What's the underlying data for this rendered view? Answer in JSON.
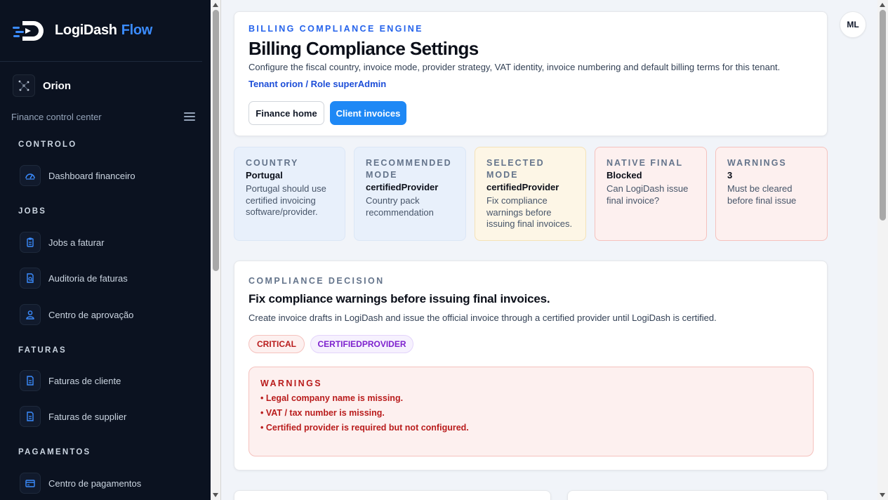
{
  "brand": {
    "name": "LogiDash",
    "flow": "Flow"
  },
  "tenant": {
    "name": "Orion",
    "subtitle": "Finance control center"
  },
  "sidebar": {
    "sections": [
      {
        "title": "CONTROLO",
        "items": [
          {
            "label": "Dashboard financeiro",
            "icon": "gauge-icon"
          }
        ]
      },
      {
        "title": "JOBS",
        "items": [
          {
            "label": "Jobs a faturar",
            "icon": "clipboard-icon"
          },
          {
            "label": "Auditoria de faturas",
            "icon": "document-search-icon"
          },
          {
            "label": "Centro de aprovação",
            "icon": "user-check-icon"
          }
        ]
      },
      {
        "title": "FATURAS",
        "items": [
          {
            "label": "Faturas de cliente",
            "icon": "document-icon"
          },
          {
            "label": "Faturas de supplier",
            "icon": "document-icon"
          }
        ]
      },
      {
        "title": "PAGAMENTOS",
        "items": [
          {
            "label": "Centro de pagamentos",
            "icon": "card-icon"
          }
        ]
      }
    ]
  },
  "header": {
    "eyebrow": "BILLING COMPLIANCE ENGINE",
    "title": "Billing Compliance Settings",
    "description": "Configure the fiscal country, invoice mode, provider strategy, VAT identity, invoice numbering and default billing terms for this tenant.",
    "tenant_line": "Tenant orion / Role superAdmin",
    "btn_home": "Finance home",
    "btn_invoices": "Client invoices"
  },
  "user": {
    "initials": "ML"
  },
  "stats": [
    {
      "label": "COUNTRY",
      "value": "Portugal",
      "desc": "Portugal should use certified invoicing software/provider."
    },
    {
      "label": "RECOMMENDED MODE",
      "value": "certifiedProvider",
      "desc": "Country pack recommendation"
    },
    {
      "label": "SELECTED MODE",
      "value": "certifiedProvider",
      "desc": "Fix compliance warnings before issuing final invoices."
    },
    {
      "label": "NATIVE FINAL",
      "value": "Blocked",
      "desc": "Can LogiDash issue final invoice?"
    },
    {
      "label": "WARNINGS",
      "value": "3",
      "desc": "Must be cleared before final issue"
    }
  ],
  "decision": {
    "eyebrow": "COMPLIANCE DECISION",
    "title": "Fix compliance warnings before issuing final invoices.",
    "description": "Create invoice drafts in LogiDash and issue the official invoice through a certified provider until LogiDash is certified.",
    "pill_critical": "CRITICAL",
    "pill_mode": "CERTIFIEDPROVIDER",
    "warnings_title": "WARNINGS",
    "warnings": [
      "• Legal company name is missing.",
      "• VAT / tax number is missing.",
      "• Certified provider is required but not configured."
    ]
  },
  "colors": {
    "accent": "#1e88f5",
    "sidebar_bg": "#0b1220",
    "warning": "#b91c1c"
  }
}
